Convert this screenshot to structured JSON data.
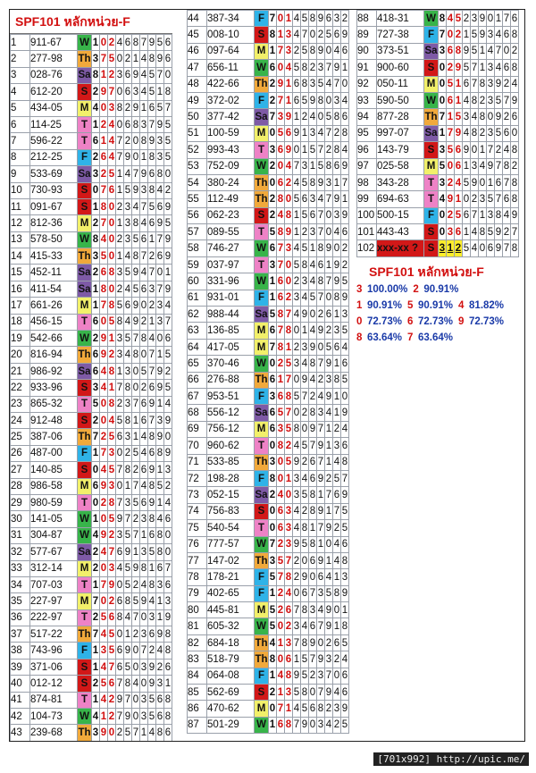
{
  "title": "SPF101 หลักหน่วย-F",
  "stats_title": "SPF101 หลักหน่วย-F",
  "footer": "[701x992] http://upic.me/",
  "prediction": {
    "n": "102",
    "code": "xxx-xx ?",
    "day": "S",
    "hl": [
      "3",
      "1",
      "2"
    ],
    "rest": [
      "5",
      "4",
      "0",
      "6",
      "9",
      "7",
      "8"
    ]
  },
  "rows": [
    [
      "1",
      "911-67",
      "W",
      "1024687956"
    ],
    [
      "2",
      "277-98",
      "Th",
      "3750214896"
    ],
    [
      "3",
      "028-76",
      "Sa",
      "8123694570"
    ],
    [
      "4",
      "612-20",
      "S",
      "2970634518"
    ],
    [
      "5",
      "434-05",
      "M",
      "4038291657"
    ],
    [
      "6",
      "114-25",
      "T",
      "1240683795"
    ],
    [
      "7",
      "596-22",
      "T",
      "6147208935"
    ],
    [
      "8",
      "212-25",
      "F",
      "2647901835"
    ],
    [
      "9",
      "533-69",
      "Sa",
      "3251479680"
    ],
    [
      "10",
      "730-93",
      "S",
      "0761593842"
    ],
    [
      "11",
      "091-67",
      "S",
      "1802347569"
    ],
    [
      "12",
      "812-36",
      "M",
      "2701384695"
    ],
    [
      "13",
      "578-50",
      "W",
      "8402356179"
    ],
    [
      "14",
      "415-33",
      "Th",
      "3501487269"
    ],
    [
      "15",
      "452-11",
      "Sa",
      "2683594701"
    ],
    [
      "16",
      "411-54",
      "Sa",
      "1802456379"
    ],
    [
      "17",
      "661-26",
      "M",
      "1785690234"
    ],
    [
      "18",
      "456-15",
      "T",
      "6058492137"
    ],
    [
      "19",
      "542-66",
      "W",
      "2913578406"
    ],
    [
      "20",
      "816-94",
      "Th",
      "6923480715"
    ],
    [
      "21",
      "986-92",
      "Sa",
      "6481305792"
    ],
    [
      "22",
      "933-96",
      "S",
      "3417802695"
    ],
    [
      "23",
      "865-32",
      "T",
      "5082376914"
    ],
    [
      "24",
      "912-48",
      "S",
      "2045816739"
    ],
    [
      "25",
      "387-06",
      "Th",
      "7256314890"
    ],
    [
      "26",
      "487-00",
      "F",
      "1730254689"
    ],
    [
      "27",
      "140-85",
      "S",
      "0457826913"
    ],
    [
      "28",
      "986-58",
      "M",
      "6930174852"
    ],
    [
      "29",
      "980-59",
      "T",
      "0287356914"
    ],
    [
      "30",
      "141-05",
      "W",
      "1059723846"
    ],
    [
      "31",
      "304-87",
      "W",
      "4923571680"
    ],
    [
      "32",
      "577-67",
      "Sa",
      "2476913580"
    ],
    [
      "33",
      "312-14",
      "M",
      "2034598167"
    ],
    [
      "34",
      "707-03",
      "T",
      "1790524836"
    ],
    [
      "35",
      "227-97",
      "M",
      "7026859413"
    ],
    [
      "36",
      "222-97",
      "T",
      "2568470319"
    ],
    [
      "37",
      "517-22",
      "Th",
      "7450123698"
    ],
    [
      "38",
      "743-96",
      "F",
      "1356907248"
    ],
    [
      "39",
      "371-06",
      "S",
      "1476503926"
    ],
    [
      "40",
      "012-12",
      "S",
      "2567840931"
    ],
    [
      "41",
      "874-81",
      "T",
      "1429703568"
    ],
    [
      "42",
      "104-73",
      "W",
      "4127903568"
    ],
    [
      "43",
      "239-68",
      "Th",
      "3902571486"
    ],
    [
      "44",
      "387-34",
      "F",
      "7014589632"
    ],
    [
      "45",
      "008-10",
      "S",
      "8134702569"
    ],
    [
      "46",
      "097-64",
      "M",
      "1732589046"
    ],
    [
      "47",
      "656-11",
      "W",
      "6045823791"
    ],
    [
      "48",
      "422-66",
      "Th",
      "2916835470"
    ],
    [
      "49",
      "372-02",
      "F",
      "2716598034"
    ],
    [
      "50",
      "377-42",
      "Sa",
      "7391240586"
    ],
    [
      "51",
      "100-59",
      "M",
      "0569134728"
    ],
    [
      "52",
      "993-43",
      "T",
      "3690157284"
    ],
    [
      "53",
      "752-09",
      "W",
      "2047315869"
    ],
    [
      "54",
      "380-24",
      "Th",
      "0624589317"
    ],
    [
      "55",
      "112-49",
      "Th",
      "2805634791"
    ],
    [
      "56",
      "062-23",
      "S",
      "2481567039"
    ],
    [
      "57",
      "089-55",
      "T",
      "5891237046"
    ],
    [
      "58",
      "746-27",
      "W",
      "6734518902"
    ],
    [
      "59",
      "037-97",
      "T",
      "3705846192"
    ],
    [
      "60",
      "331-96",
      "W",
      "1602348795"
    ],
    [
      "61",
      "931-01",
      "F",
      "1623457089"
    ],
    [
      "62",
      "988-44",
      "Sa",
      "5874902613"
    ],
    [
      "63",
      "136-85",
      "M",
      "6780149235"
    ],
    [
      "64",
      "417-05",
      "M",
      "7812390564"
    ],
    [
      "65",
      "370-46",
      "W",
      "0253487916"
    ],
    [
      "66",
      "276-88",
      "Th",
      "6170942385"
    ],
    [
      "67",
      "953-51",
      "F",
      "3685724910"
    ],
    [
      "68",
      "556-12",
      "Sa",
      "6570283419"
    ],
    [
      "69",
      "756-12",
      "M",
      "6358097124"
    ],
    [
      "70",
      "960-62",
      "T",
      "0824579136"
    ],
    [
      "71",
      "533-85",
      "Th",
      "3059267148"
    ],
    [
      "72",
      "198-28",
      "F",
      "8013469257"
    ],
    [
      "73",
      "052-15",
      "Sa",
      "2403581769"
    ],
    [
      "74",
      "756-83",
      "S",
      "0634289175"
    ],
    [
      "75",
      "540-54",
      "T",
      "0634817925"
    ],
    [
      "76",
      "777-57",
      "W",
      "7239581046"
    ],
    [
      "77",
      "147-02",
      "Th",
      "3572069148"
    ],
    [
      "78",
      "178-21",
      "F",
      "5782906413"
    ],
    [
      "79",
      "402-65",
      "F",
      "1240673589"
    ],
    [
      "80",
      "445-81",
      "M",
      "5267834901"
    ],
    [
      "81",
      "605-32",
      "W",
      "5023467918"
    ],
    [
      "82",
      "684-18",
      "Th",
      "4137890265"
    ],
    [
      "83",
      "518-79",
      "Th",
      "8061579324"
    ],
    [
      "84",
      "064-08",
      "F",
      "1489523706"
    ],
    [
      "85",
      "562-69",
      "S",
      "2135807946"
    ],
    [
      "86",
      "470-62",
      "M",
      "0714568239"
    ],
    [
      "87",
      "501-29",
      "W",
      "1687903425"
    ],
    [
      "88",
      "418-31",
      "W",
      "8452390176"
    ],
    [
      "89",
      "727-38",
      "F",
      "7021593468"
    ],
    [
      "90",
      "373-51",
      "Sa",
      "3689514702"
    ],
    [
      "91",
      "900-60",
      "S",
      "0295713468"
    ],
    [
      "92",
      "050-11",
      "M",
      "0516783924"
    ],
    [
      "93",
      "590-50",
      "W",
      "0614823579"
    ],
    [
      "94",
      "877-28",
      "Th",
      "7153480926"
    ],
    [
      "95",
      "997-07",
      "Sa",
      "1794823560"
    ],
    [
      "96",
      "143-79",
      "S",
      "3569017248"
    ],
    [
      "97",
      "025-58",
      "M",
      "5061349782"
    ],
    [
      "98",
      "343-28",
      "T",
      "3245901678"
    ],
    [
      "99",
      "694-63",
      "T",
      "4910235768"
    ],
    [
      "100",
      "500-15",
      "F",
      "0256713849"
    ],
    [
      "101",
      "443-43",
      "S",
      "0361485927"
    ]
  ],
  "stats": [
    [
      [
        "3",
        "100.00%"
      ],
      [
        "2",
        "90.91%"
      ]
    ],
    [
      [
        "1",
        "90.91%"
      ],
      [
        "5",
        "90.91%"
      ],
      [
        "4",
        "81.82%"
      ]
    ],
    [
      [
        "0",
        "72.73%"
      ],
      [
        "6",
        "72.73%"
      ],
      [
        "9",
        "72.73%"
      ]
    ],
    [
      [
        "8",
        "63.64%"
      ],
      [
        "7",
        "63.64%"
      ]
    ]
  ]
}
